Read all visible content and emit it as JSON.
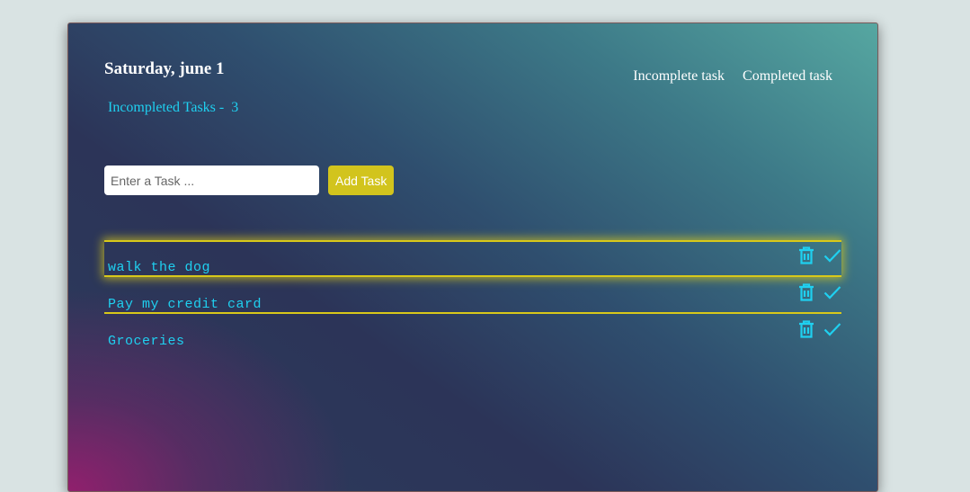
{
  "header": {
    "date": "Saturday, june 1",
    "incomplete_label": "Incompleted Tasks -",
    "incomplete_count": "3"
  },
  "nav": {
    "incomplete_link": "Incomplete task",
    "completed_link": "Completed task"
  },
  "form": {
    "placeholder": "Enter a Task ...",
    "add_label": "Add Task"
  },
  "tasks": [
    {
      "text": "walk the dog"
    },
    {
      "text": "Pay my credit card"
    },
    {
      "text": "Groceries"
    }
  ],
  "icons": {
    "delete": "trash-icon",
    "complete": "check-icon"
  },
  "colors": {
    "accent_cyan": "#1fd0f0",
    "accent_yellow": "#d2c41d"
  }
}
